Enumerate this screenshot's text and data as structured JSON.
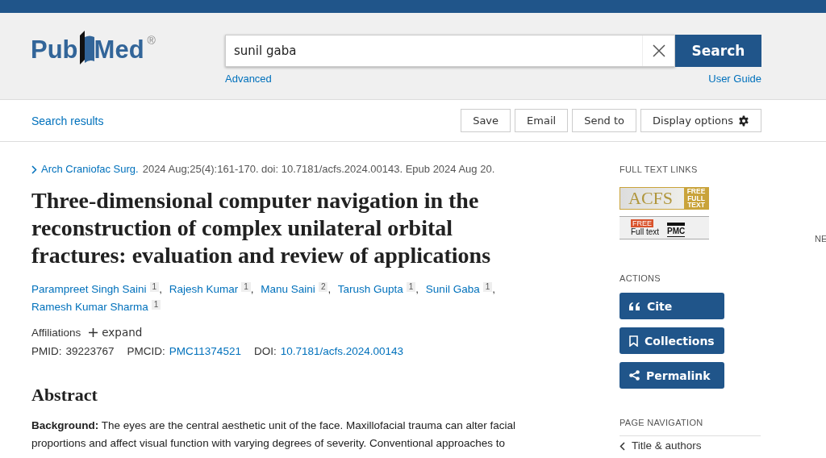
{
  "header": {
    "logo": {
      "text_left": "Pub",
      "text_right": "Med",
      "mark": "®"
    },
    "search": {
      "value": "sunil gaba",
      "button": "Search"
    },
    "advanced_link": "Advanced",
    "user_guide_link": "User Guide"
  },
  "toolbar": {
    "back_link": "Search results",
    "buttons": [
      {
        "label": "Save",
        "kind": "plain"
      },
      {
        "label": "Email",
        "kind": "plain"
      },
      {
        "label": "Send to",
        "kind": "plain"
      },
      {
        "label": "Display options",
        "kind": "gear"
      }
    ]
  },
  "article": {
    "journal_link": "Arch Craniofac Surg.",
    "citation": "2024 Aug;25(4):161-170. doi: 10.7181/acfs.2024.00143. Epub 2024 Aug 20.",
    "title": "Three-dimensional computer navigation in the reconstruction of complex unilateral orbital fractures: evaluation and review of applications",
    "authors": [
      {
        "name": "Parampreet Singh Saini",
        "affiliation": "1",
        "sep": ","
      },
      {
        "name": "Rajesh Kumar",
        "affiliation": "1",
        "sep": ","
      },
      {
        "name": "Manu Saini",
        "affiliation": "2",
        "sep": ","
      },
      {
        "name": "Tarush Gupta",
        "affiliation": "1",
        "sep": ","
      },
      {
        "name": "Sunil Gaba",
        "affiliation": "1",
        "sep": ","
      },
      {
        "name": "Ramesh Kumar Sharma",
        "affiliation": "1"
      }
    ],
    "affiliations": {
      "label": "Affiliations",
      "toggle": "expand",
      "expanded": false
    },
    "ids": [
      {
        "label": "PMID:",
        "value": "39223767",
        "link": false
      },
      {
        "label": "PMCID:",
        "value": "PMC11374521",
        "link": true
      },
      {
        "label": "DOI:",
        "value": "10.7181/acfs.2024.00143",
        "link": true
      }
    ],
    "abstract": {
      "heading": "Abstract",
      "text": "**Background:** The eyes are the central aesthetic unit of the face. Maxillofacial trauma can alter facial proportions and affect visual function with varying degrees of severity. Conventional approaches to"
    }
  },
  "sidebar": {
    "full_text_heading": "FULL TEXT LINKS",
    "acfs_badge": {
      "name": "ACFS",
      "tag": "FREE FULL TEXT"
    },
    "pmc_badge": {
      "free": "FREE",
      "label": "Full text",
      "name": "PMC"
    },
    "actions_heading": "ACTIONS",
    "actions": [
      {
        "label": "Cite",
        "kind": "cite"
      },
      {
        "label": "Collections",
        "kind": "collections"
      },
      {
        "label": "Permalink",
        "kind": "permalink"
      }
    ],
    "page_nav_heading": "PAGE NAVIGATION",
    "page_nav": [
      {
        "label": "Title & authors"
      }
    ]
  },
  "far_right_text": "NE"
}
